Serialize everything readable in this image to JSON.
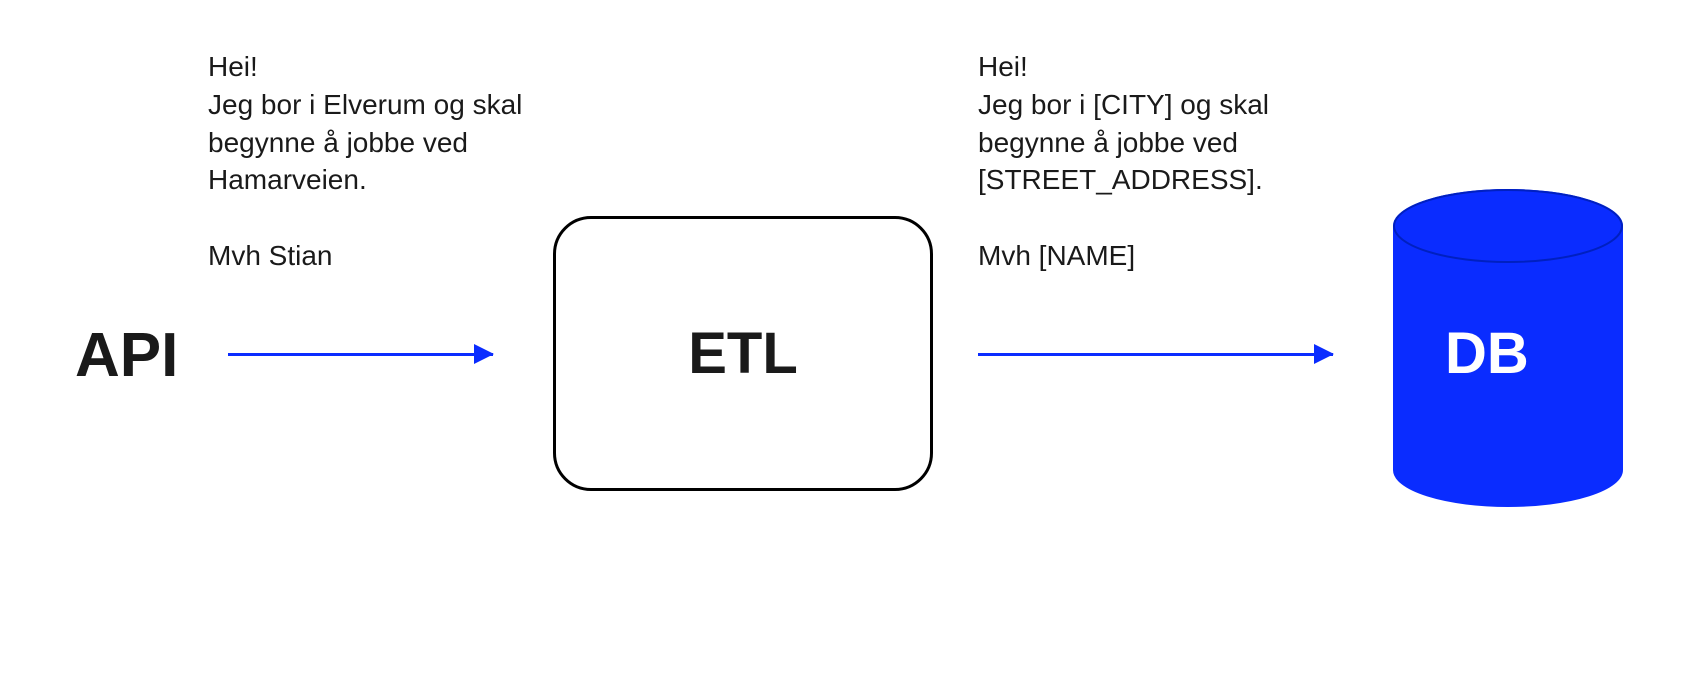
{
  "nodes": {
    "api": {
      "label": "API"
    },
    "etl": {
      "label": "ETL"
    },
    "db": {
      "label": "DB"
    }
  },
  "text_left": "Hei!\nJeg bor i Elverum og skal begynne å jobbe ved Hamarveien.\n\nMvh Stian",
  "text_right": "Hei!\nJeg bor i [CITY] og skal begynne å jobbe ved [STREET_ADDRESS].\n\nMvh [NAME]",
  "colors": {
    "arrow": "#0a2cff",
    "db_fill": "#0a2cff",
    "db_stroke": "#0a2cff",
    "text": "#1a1a1a"
  }
}
